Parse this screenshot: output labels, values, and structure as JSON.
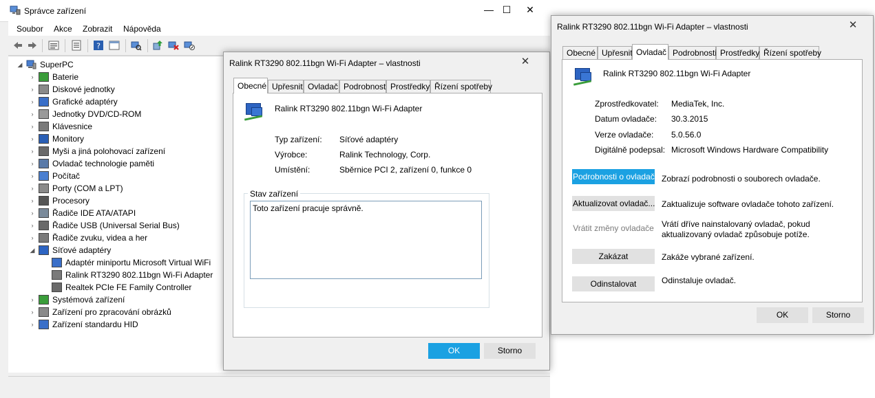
{
  "device_manager": {
    "title": "Správce zařízení",
    "window_controls": {
      "minimize": "—",
      "maximize": "☐",
      "close": "✕"
    },
    "menu": [
      "Soubor",
      "Akce",
      "Zobrazit",
      "Nápověda"
    ],
    "tree": {
      "root": "SuperPC",
      "categories": [
        "Baterie",
        "Diskové jednotky",
        "Grafické adaptéry",
        "Jednotky DVD/CD-ROM",
        "Klávesnice",
        "Monitory",
        "Myši a jiná polohovací zařízení",
        "Ovladač technologie paměti",
        "Počítač",
        "Porty (COM a LPT)",
        "Procesory",
        "Řadiče IDE ATA/ATAPI",
        "Řadiče USB (Universal Serial Bus)",
        "Řadiče zvuku, videa a her",
        "Síťové adaptéry"
      ],
      "network_children": [
        "Adaptér miniportu Microsoft Virtual WiFi",
        "Ralink RT3290 802.11bgn Wi-Fi Adapter",
        "Realtek PCIe FE Family Controller"
      ],
      "after_categories": [
        "Systémová zařízení",
        "Zařízení pro zpracování obrázků",
        "Zařízení standardu HID"
      ],
      "expanded_glyph": "◢",
      "collapsed_glyph": "›"
    }
  },
  "properties_general": {
    "title": "Ralink RT3290 802.11bgn Wi-Fi Adapter – vlastnosti",
    "close": "✕",
    "tabs": [
      "Obecné",
      "Upřesnit",
      "Ovladač",
      "Podrobnosti",
      "Prostředky",
      "Řízení spotřeby"
    ],
    "active_tab": "Obecné",
    "device_name": "Ralink RT3290 802.11bgn Wi-Fi Adapter",
    "fields": [
      {
        "label": "Typ zařízení:",
        "value": "Síťové adaptéry"
      },
      {
        "label": "Výrobce:",
        "value": "Ralink Technology, Corp."
      },
      {
        "label": "Umístění:",
        "value": "Sběrnice PCI 2, zařízení 0, funkce 0"
      }
    ],
    "status_group_label": "Stav zařízení",
    "status_text": "Toto zařízení pracuje správně.",
    "ok": "OK",
    "cancel": "Storno"
  },
  "properties_driver": {
    "title": "Ralink RT3290 802.11bgn Wi-Fi Adapter – vlastnosti",
    "close": "✕",
    "tabs": [
      "Obecné",
      "Upřesnit",
      "Ovladač",
      "Podrobnosti",
      "Prostředky",
      "Řízení spotřeby"
    ],
    "active_tab": "Ovladač",
    "device_name": "Ralink RT3290 802.11bgn Wi-Fi Adapter",
    "fields": [
      {
        "label": "Zprostředkovatel:",
        "value": "MediaTek, Inc."
      },
      {
        "label": "Datum ovladače:",
        "value": "30.3.2015"
      },
      {
        "label": "Verze ovladače:",
        "value": "5.0.56.0"
      },
      {
        "label": "Digitálně podepsal:",
        "value": "Microsoft Windows Hardware Compatibility"
      }
    ],
    "actions": [
      {
        "button": "Podrobnosti o ovladači",
        "desc": "Zobrazí podrobnosti o souborech ovladače."
      },
      {
        "button": "Aktualizovat ovladač...",
        "desc": "Zaktualizuje software ovladače tohoto zařízení."
      },
      {
        "button": "Vrátit změny ovladače",
        "desc": "Vrátí dříve nainstalovaný ovladač, pokud aktualizovaný ovladač způsobuje potíže."
      },
      {
        "button": "Zakázat",
        "desc": "Zakáže vybrané zařízení."
      },
      {
        "button": "Odinstalovat",
        "desc": "Odinstaluje ovladač."
      }
    ],
    "ok": "OK",
    "cancel": "Storno"
  },
  "colors": {
    "accent": "#1ba1e2",
    "window_bg": "#f0f0f0",
    "panel_bg": "#ffffff"
  }
}
